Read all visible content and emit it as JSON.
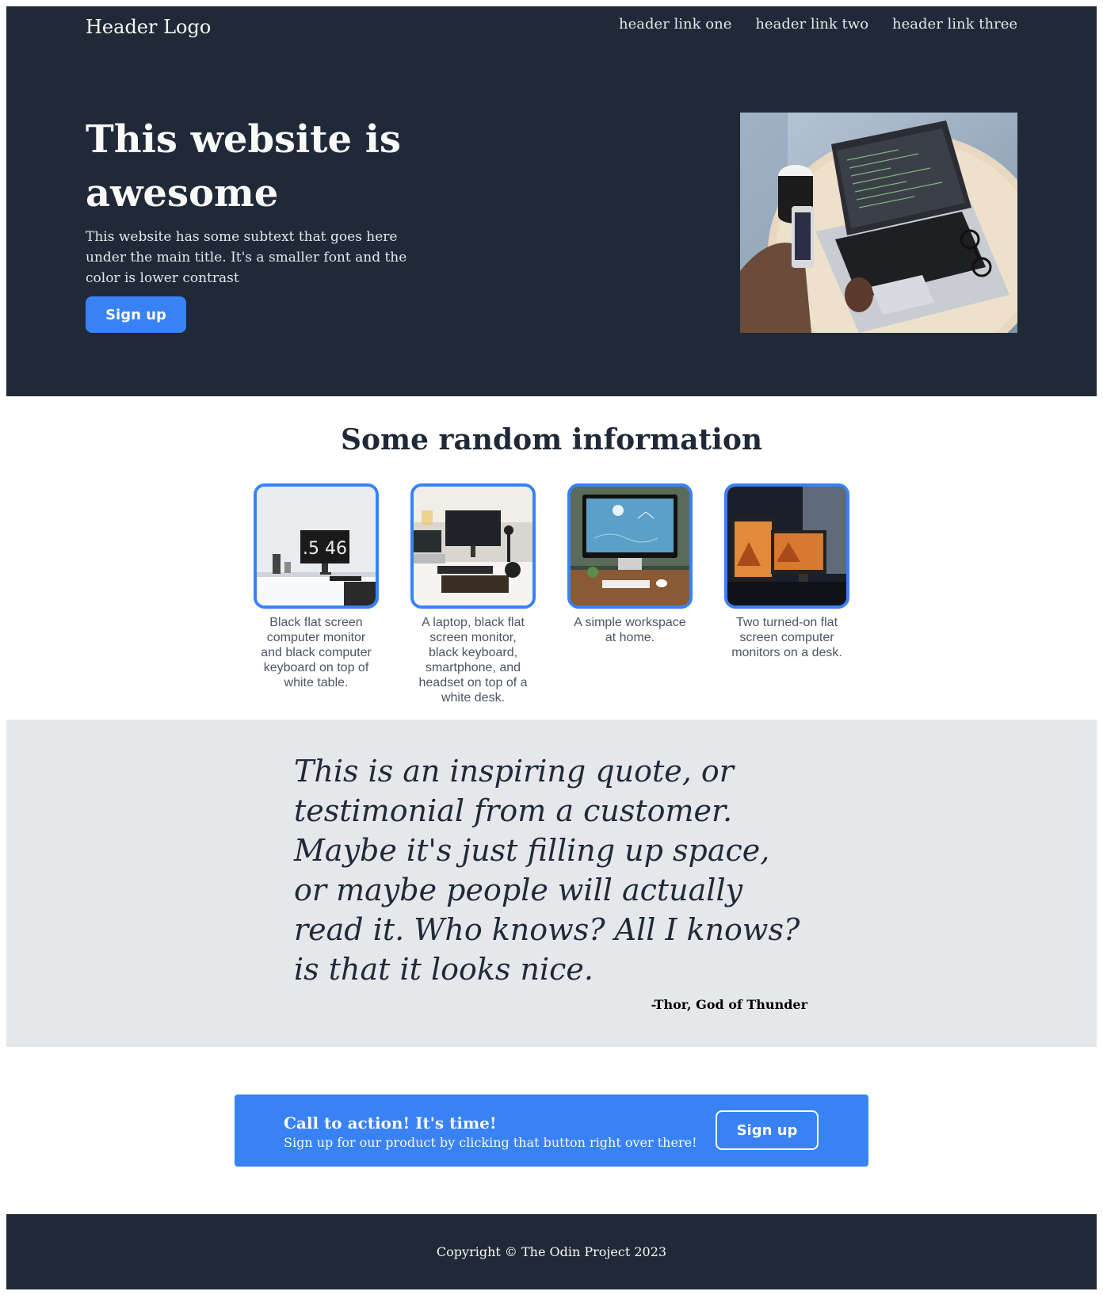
{
  "header": {
    "logo": "Header Logo",
    "links": [
      "header link one",
      "header link two",
      "header link three"
    ]
  },
  "hero": {
    "title": "This website is awesome",
    "subtext": "This website has some subtext that goes here under the main title. It's a smaller font and the color is lower contrast",
    "button_label": "Sign up",
    "image_description": "laptop-with-code-on-round-table"
  },
  "info": {
    "title": "Some random information",
    "cards": [
      {
        "text": "Black flat screen computer monitor and black computer keyboard on top of white table."
      },
      {
        "text": "A laptop, black flat screen monitor, black keyboard, smartphone, and headset on top of a white desk."
      },
      {
        "text": "A simple workspace at home."
      },
      {
        "text": "Two turned-on flat screen computer monitors on a desk."
      }
    ]
  },
  "quote": {
    "text": "This is an inspiring quote, or testimonial from a customer. Maybe it's just filling up space, or maybe people will actually read it. Who knows? All I knows? is that it looks nice.",
    "author": "-Thor, God of Thunder"
  },
  "cta": {
    "title": "Call to action! It's time!",
    "subtext": "Sign up for our product by clicking that button right over there!",
    "button_label": "Sign up"
  },
  "footer": {
    "copyright": "Copyright © The Odin Project 2023"
  },
  "colors": {
    "dark": "#1f2937",
    "accent": "#3882f6",
    "light_gray": "#e5e7eb",
    "text_light": "#f9faf8",
    "text_muted": "#4b5563"
  }
}
